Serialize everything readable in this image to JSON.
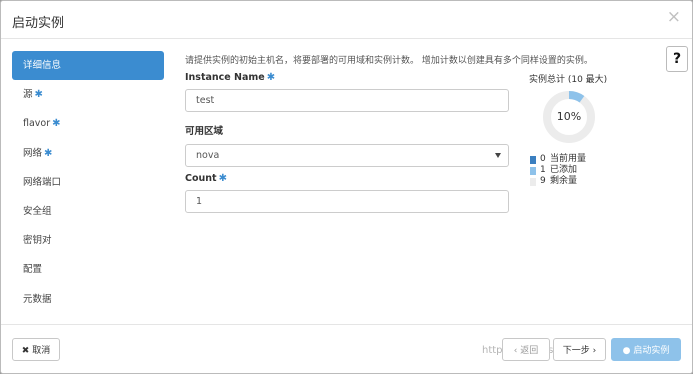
{
  "modal": {
    "title": "启动实例",
    "close_glyph": "×",
    "help_glyph": "?"
  },
  "sidebar": {
    "items": [
      {
        "label": "详细信息",
        "required": false,
        "active": true
      },
      {
        "label": "源",
        "required": true,
        "active": false
      },
      {
        "label": "flavor",
        "required": true,
        "active": false
      },
      {
        "label": "网络",
        "required": true,
        "active": false
      },
      {
        "label": "网络端口",
        "required": false,
        "active": false
      },
      {
        "label": "安全组",
        "required": false,
        "active": false
      },
      {
        "label": "密钥对",
        "required": false,
        "active": false
      },
      {
        "label": "配置",
        "required": false,
        "active": false
      },
      {
        "label": "元数据",
        "required": false,
        "active": false
      }
    ],
    "required_mark": "✱"
  },
  "main": {
    "description": "请提供实例的初始主机名，将要部署的可用域和实例计数。 增加计数以创建具有多个同样设置的实例。",
    "instance_name": {
      "label": "Instance Name",
      "value": "test"
    },
    "availability_zone": {
      "label": "可用区域",
      "value": "nova"
    },
    "count": {
      "label": "Count",
      "value": "1"
    }
  },
  "quota": {
    "title": "实例总计 (10 最大)",
    "percent_label": "10%",
    "used_fraction": 0.0,
    "added_fraction": 0.1,
    "legend": [
      {
        "num": "0",
        "label": "当前用量",
        "color": "#3b7fc0"
      },
      {
        "num": "1",
        "label": "已添加",
        "color": "#8ec2ea"
      },
      {
        "num": "9",
        "label": "剩余量",
        "color": "#ececec"
      }
    ]
  },
  "footer": {
    "cancel_label": "✖ 取消",
    "back_label": "‹ 返回",
    "next_label": "下一步 ›",
    "launch_label": "● 启动实例",
    "watermark": "https://blog.csdn.net/..."
  },
  "colors": {
    "accent": "#3b8cd0",
    "primary_disabled": "#8ec2ea"
  }
}
